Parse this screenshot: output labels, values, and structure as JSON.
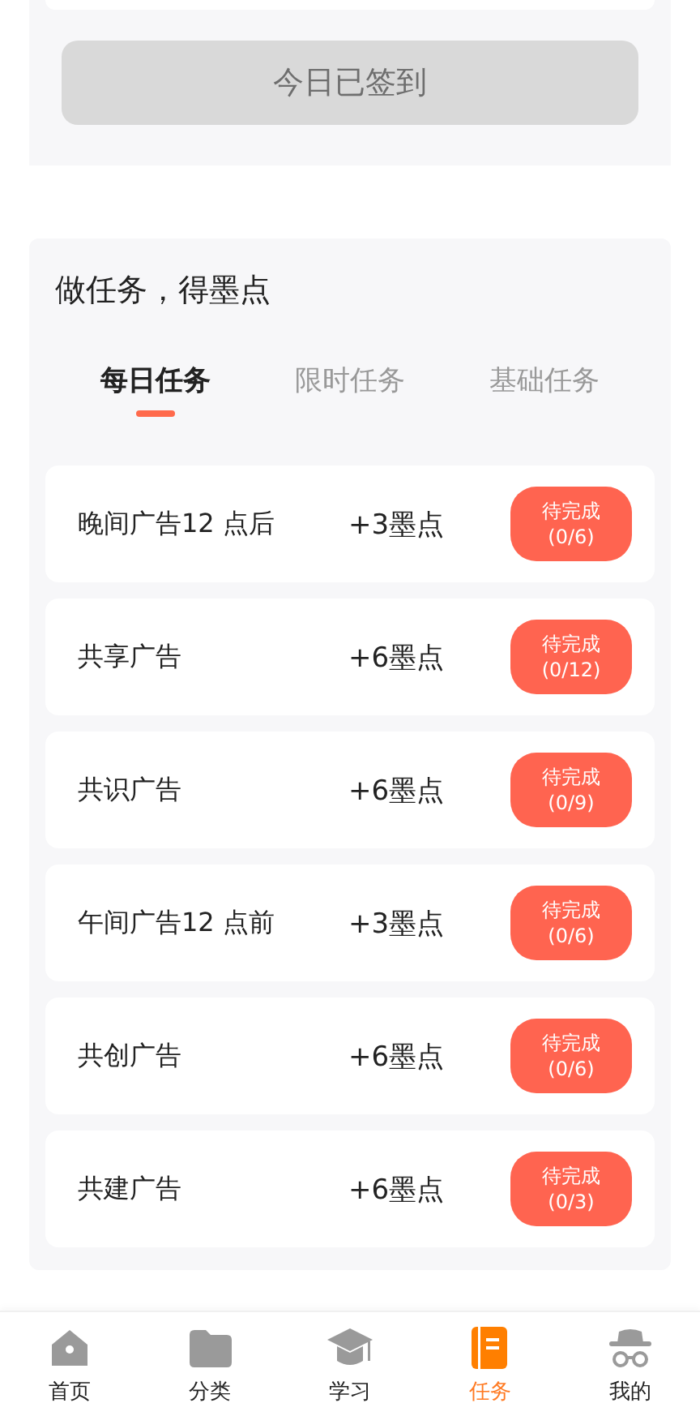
{
  "checkin": {
    "label": "今日已签到",
    "disabled": true
  },
  "tasks_section": {
    "title": "做任务，得墨点",
    "tabs": [
      {
        "label": "每日任务",
        "selected": true
      },
      {
        "label": "限时任务",
        "selected": false
      },
      {
        "label": "基础任务",
        "selected": false
      }
    ],
    "tasks": [
      {
        "name": "晚间广告12 点后",
        "reward": "+3墨点",
        "status": "待完成",
        "progress": "(0/6)",
        "done": false
      },
      {
        "name": "共享广告",
        "reward": "+6墨点",
        "status": "待完成",
        "progress": "(0/12)",
        "done": false
      },
      {
        "name": "共识广告",
        "reward": "+6墨点",
        "status": "待完成",
        "progress": "(0/9)",
        "done": false
      },
      {
        "name": "午间广告12 点前",
        "reward": "+3墨点",
        "status": "待完成",
        "progress": "(0/6)",
        "done": false
      },
      {
        "name": "共创广告",
        "reward": "+6墨点",
        "status": "待完成",
        "progress": "(0/6)",
        "done": false
      },
      {
        "name": "共建广告",
        "reward": "+6墨点",
        "status": "待完成",
        "progress": "(0/3)",
        "done": false
      }
    ]
  },
  "tab_bar": [
    {
      "kind": "home",
      "label": "首页",
      "selected": false
    },
    {
      "kind": "category",
      "label": "分类",
      "selected": false
    },
    {
      "kind": "study",
      "label": "学习",
      "selected": false
    },
    {
      "kind": "tasks",
      "label": "任务",
      "selected": true
    },
    {
      "kind": "mine",
      "label": "我的",
      "selected": false
    }
  ]
}
